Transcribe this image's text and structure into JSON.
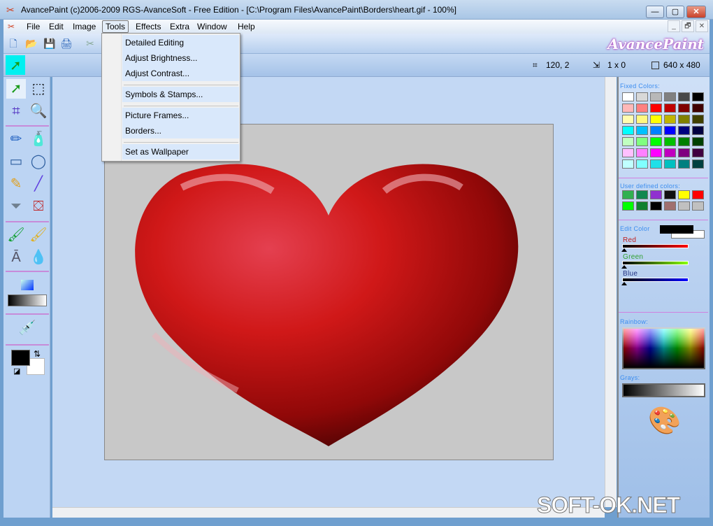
{
  "window": {
    "title": "AvancePaint (c)2006-2009 RGS-AvanceSoft - Free Edition - [C:\\Program Files\\AvancePaint\\Borders\\heart.gif - 100%]",
    "minimize": "—",
    "maximize": "▢",
    "close": "✕"
  },
  "menubar": {
    "items": [
      "File",
      "Edit",
      "Image",
      "Tools",
      "Effects",
      "Extra",
      "Window",
      "Help"
    ],
    "active": "Tools",
    "mdi": [
      "_",
      "🗗",
      "✕"
    ]
  },
  "toolbar": {
    "icons": [
      "new-icon",
      "open-icon",
      "save-icon",
      "print-icon",
      "cut-icon"
    ],
    "logo": "AvancePaint"
  },
  "status": {
    "position": "120, 2",
    "selection_size": "1 x 0",
    "image_size": "640 x 480"
  },
  "tools_menu": {
    "groups": [
      [
        "Detailed Editing",
        "Adjust Brightness...",
        "Adjust Contrast..."
      ],
      [
        "Symbols & Stamps..."
      ],
      [
        "Picture Frames...",
        "Borders..."
      ],
      [
        "Set as Wallpaper"
      ]
    ]
  },
  "right_panel": {
    "fixed_colors_label": "Fixed Colors:",
    "fixed_colors": [
      "#ffffff",
      "#d8d8d8",
      "#b8b8b8",
      "#808080",
      "#484848",
      "#000000",
      "#ffb8b8",
      "#ff8080",
      "#ff0000",
      "#c00000",
      "#800000",
      "#400000",
      "#fffcb0",
      "#fff880",
      "#ffff00",
      "#c0b400",
      "#808000",
      "#404000",
      "#00ffff",
      "#00c0ff",
      "#0080ff",
      "#0000ff",
      "#000080",
      "#000040",
      "#c0ffc0",
      "#80ff80",
      "#00ff00",
      "#00c000",
      "#008000",
      "#004000",
      "#ffc0ff",
      "#ff80ff",
      "#ff00ff",
      "#c000c0",
      "#800080",
      "#400040",
      "#c0ffff",
      "#80ffff",
      "#20e0e8",
      "#00c0c0",
      "#008080",
      "#004040"
    ],
    "user_colors_label": "User defined colors:",
    "user_colors": [
      "#30b050",
      "#108850",
      "#9030d0",
      "#101010",
      "#ffff00",
      "#ff0000",
      "#00ff00",
      "#108030",
      "#000000",
      "#a07070",
      "#c0c0c0",
      "#c0c0c0"
    ],
    "edit_color_label": "Edit Color",
    "red_label": "Red",
    "green_label": "Green",
    "blue_label": "Blue",
    "rgb": [
      0,
      0,
      0
    ],
    "rainbow_label": "Rainbow:",
    "grays_label": "Grays:"
  },
  "colors": {
    "foreground": "#000000",
    "background": "#ffffff",
    "accent": "#c78bd9"
  },
  "watermark": "SOFT-OK.NET"
}
